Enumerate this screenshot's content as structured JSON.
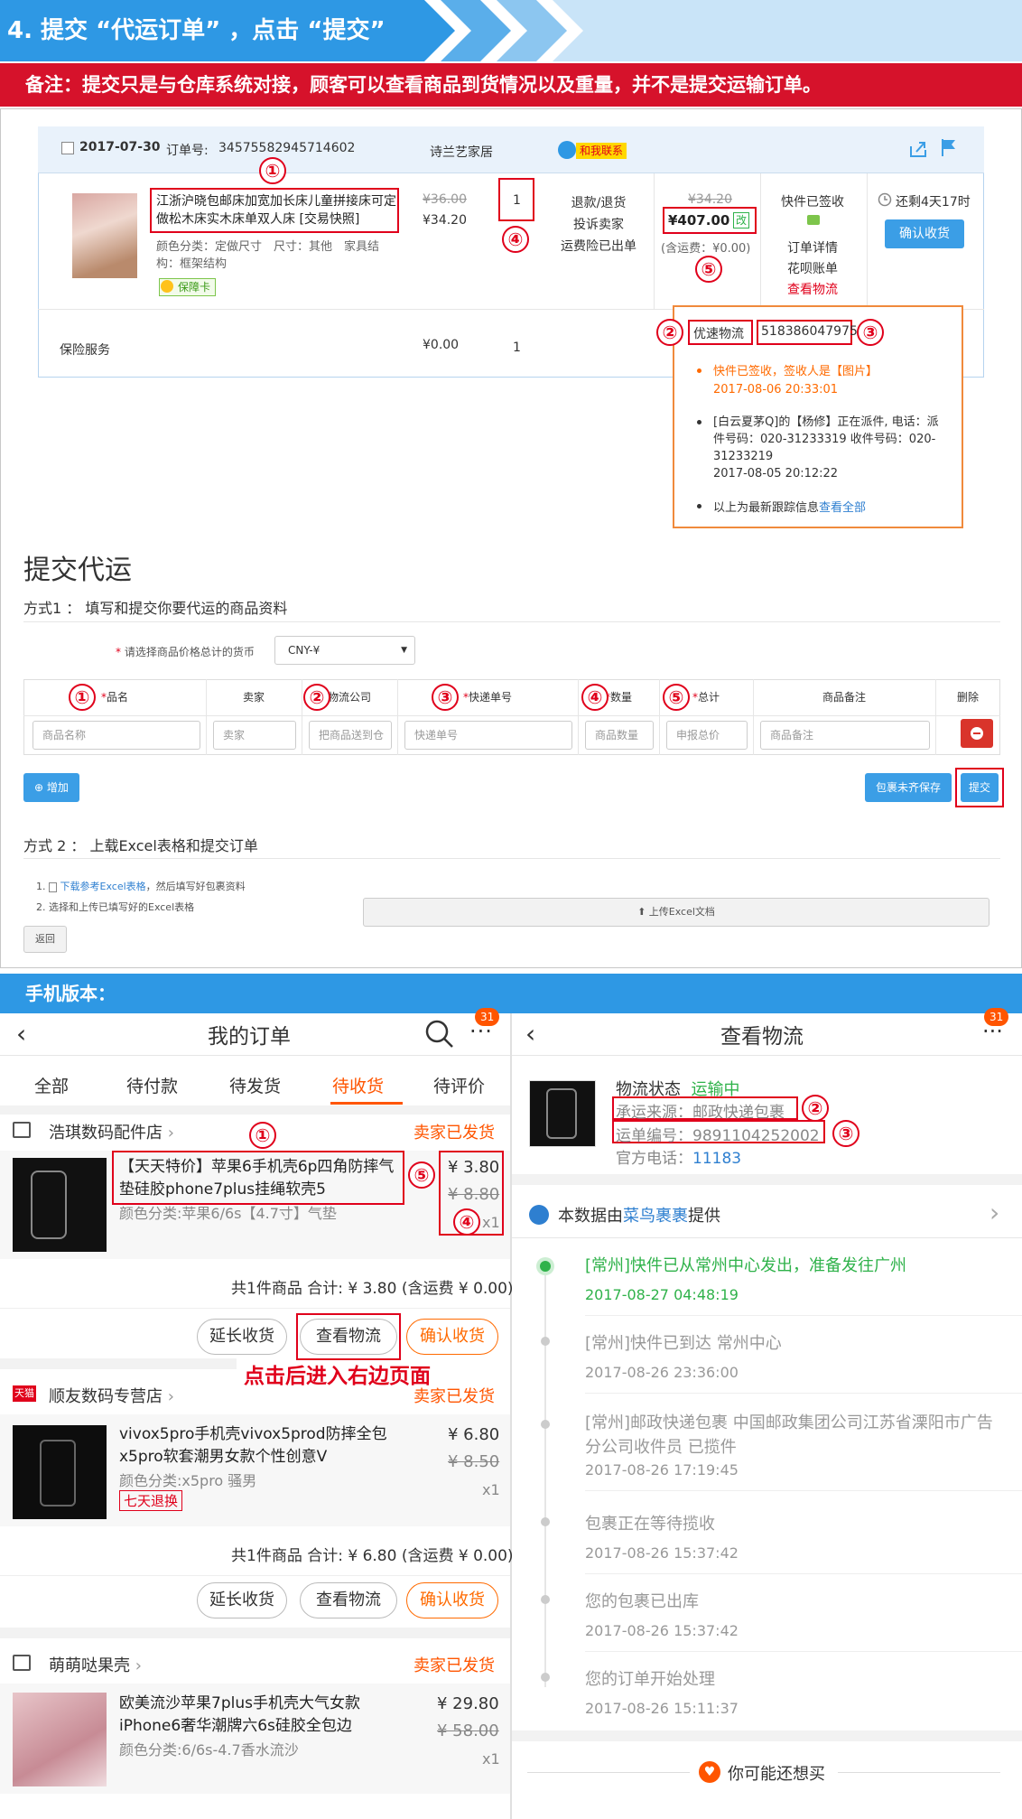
{
  "step_title": "4. 提交 “代运订单” ，点击 “提交”",
  "note": "备注：提交只是与仓库系统对接，顾客可以查看商品到货情况以及重量，并不是提交运输订单。",
  "order": {
    "date": "2017-07-30",
    "order_no_label": "订单号:",
    "order_no": "34575582945714602",
    "shop": "诗兰艺家居",
    "contact": "和我联系",
    "title": "江浙沪晓包邮床加宽加长床儿童拼接床可定做松木床实木床单双人床 [交易快照]",
    "attrs": "颜色分类：定做尺寸　尺寸：其他　家具结构：框架结构",
    "badge": "保障卡",
    "price_orig": "¥36.00",
    "price_now": "¥34.20",
    "qty": "1",
    "actions": [
      "退款/退货",
      "投诉卖家",
      "运费险已出单"
    ],
    "total_orig": "¥34.20",
    "total": "¥407.00",
    "total_mark": "改",
    "shipping": "(含运费：¥0.00)",
    "status": "快件已签收",
    "status_links": [
      "订单详情",
      "花呗账单",
      "查看物流"
    ],
    "remain": "还剩4天17时",
    "confirm": "确认收货",
    "insurance": "保险服务",
    "ins_price": "¥0.00",
    "ins_qty": "1"
  },
  "popup": {
    "carrier": "优速物流",
    "tracking": "518386047975",
    "items": [
      {
        "text": "快件已签收，签收人是【图片】",
        "time": "2017-08-06 20:33:01",
        "highlight": true
      },
      {
        "text": "[白云夏茅Q]的【杨修】正在派件, 电话：派件号码：020-31233319 收件号码：020-31233219",
        "time": "2017-08-05 20:12:22",
        "highlight": false
      }
    ],
    "footer_text": "以上为最新跟踪信息",
    "footer_link": "查看全部"
  },
  "markers": [
    "①",
    "②",
    "③",
    "④",
    "⑤"
  ],
  "form": {
    "title": "提交代运",
    "method1": "方式1 ： 填写和提交你要代运的商品资料",
    "currency_label": "请选择商品价格总计的货币",
    "currency_value": "CNY-¥",
    "columns": [
      "品名",
      "卖家",
      "物流公司",
      "快递单号",
      "数量",
      "总计",
      "商品备注",
      "删除"
    ],
    "placeholders": [
      "商品名称",
      "卖家",
      "把商品送到仓",
      "快递单号",
      "商品数量",
      "申报总价",
      "商品备注"
    ],
    "add": "增加",
    "save": "包裹未齐保存",
    "submit": "提交",
    "method2": "方式 2 ： 上载Excel表格和提交订单",
    "step1_link": "下载参考Excel表格",
    "step1_rest": "，然后填写好包裹资料",
    "step1_num": "1.",
    "step2": "2. 选择和上传已填写好的Excel表格",
    "upload": "上传Excel文档",
    "back": "返回"
  },
  "mobile_banner": "手机版本：",
  "mobile_left": {
    "title": "我的订单",
    "badge": "31",
    "tabs": [
      "全部",
      "待付款",
      "待发货",
      "待收货",
      "待评价"
    ],
    "active_tab": 3,
    "shops": [
      {
        "name": "浩琪数码配件店",
        "status": "卖家已发货",
        "title": "【天天特价】苹果6手机壳6p四角防摔气垫硅胶phone7plus挂绳软壳5",
        "attr": "颜色分类:苹果6/6s【4.7寸】气垫",
        "price": "¥ 3.80",
        "orig": "¥ 8.80",
        "qty": "x1",
        "summary": "共1件商品 合计: ¥ 3.80 (含运费 ¥ 0.00)",
        "btns": [
          "延长收货",
          "查看物流",
          "确认收货"
        ]
      },
      {
        "name": "顺友数码专营店",
        "status": "卖家已发货",
        "title": "vivox5pro手机壳vivox5prod防摔全包x5pro软套潮男女款个性创意V",
        "attr": "颜色分类:x5pro 骚男",
        "tag": "七天退换",
        "price": "¥ 6.80",
        "orig": "¥ 8.50",
        "qty": "x1",
        "summary": "共1件商品 合计: ¥ 6.80 (含运费 ¥ 0.00)",
        "btns": [
          "延长收货",
          "查看物流",
          "确认收货"
        ]
      },
      {
        "name": "萌萌哒果壳",
        "status": "卖家已发货",
        "title": "欧美流沙苹果7plus手机壳大气女款iPhone6奢华潮牌六6s硅胶全包边",
        "attr": "颜色分类:6/6s-4.7香水流沙",
        "price": "¥ 29.80",
        "orig": "¥ 58.00",
        "qty": "x1"
      }
    ],
    "tmall": "天猫",
    "hint": "点击后进入右边页面"
  },
  "mobile_right": {
    "title": "查看物流",
    "badge": "31",
    "status_label": "物流状态",
    "status_value": "运输中",
    "source": "承运来源：邮政快递包裹",
    "waybill": "运单编号：9891104252002",
    "phone_label": "官方电话：",
    "phone": "11183",
    "provider_pre": "本数据由",
    "provider_name": "菜鸟裹裹",
    "provider_post": "提供",
    "timeline": [
      {
        "text": "[常州]快件已从常州中心发出，准备发往广州",
        "time": "2017-08-27 04:48:19"
      },
      {
        "text": "[常州]快件已到达 常州中心",
        "time": "2017-08-26 23:36:00"
      },
      {
        "text": "[常州]邮政快递包裹 中国邮政集团公司江苏省溧阳市广告分公司收件员 已揽件",
        "time": "2017-08-26 17:19:45"
      },
      {
        "text": "包裹正在等待揽收",
        "time": "2017-08-26 15:37:42"
      },
      {
        "text": "您的包裹已出库",
        "time": "2017-08-26 15:37:42"
      },
      {
        "text": "您的订单开始处理",
        "time": "2017-08-26 15:11:37"
      }
    ],
    "footer": "你可能还想买"
  },
  "colors": {
    "accent_blue": "#2e98e4",
    "red": "#e0001b",
    "orange": "#ff6a00",
    "green": "#2fb24a"
  }
}
